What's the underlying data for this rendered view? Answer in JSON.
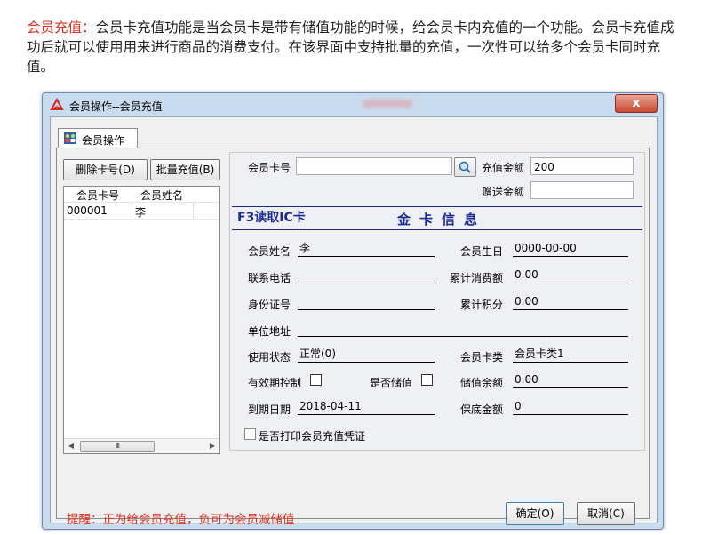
{
  "intro": {
    "highlight": "会员充值：",
    "text": "会员卡充值功能是当会员卡是带有储值功能的时候，给会员卡内充值的一个功能。会员卡充值成功后就可以使用用来进行商品的消费支付。在该界面中支持批量的充值，一次性可以给多个会员卡同时充值。"
  },
  "window": {
    "title": "会员操作--会员充值",
    "close_label": "x"
  },
  "tab": {
    "label": "会员操作"
  },
  "left_panel": {
    "delete_label": "删除卡号(D)",
    "batch_label": "批量充值(B)",
    "columns": [
      "会员卡号",
      "会员姓名"
    ],
    "rows": [
      {
        "card_no": "000001",
        "name": "李"
      }
    ],
    "scroll_thumb": "III"
  },
  "top_form": {
    "card_no_label": "会员卡号",
    "card_no_value": "",
    "recharge_label": "充值金额",
    "recharge_value": "200",
    "gift_label": "赠送金额",
    "gift_value": ""
  },
  "card_section": {
    "f3_label": "F3读取IC卡",
    "title": "金卡信息"
  },
  "card_info": {
    "name_label": "会员姓名",
    "name_value": "李",
    "birthday_label": "会员生日",
    "birthday_value": "0000-00-00",
    "phone_label": "联系电话",
    "phone_value": "",
    "consume_label": "累计消费额",
    "consume_value": "0.00",
    "id_label": "身份证号",
    "id_value": "",
    "points_label": "累计积分",
    "points_value": "0.00",
    "address_label": "单位地址",
    "address_value": "",
    "status_label": "使用状态",
    "status_value": "正常(0)",
    "cardtype_label": "会员卡类",
    "cardtype_value": "会员卡类1",
    "validity_label": "有效期控制",
    "stored_label": "是否储值",
    "balance_label": "储值余额",
    "balance_value": "0.00",
    "expire_label": "到期日期",
    "expire_value": "2018-04-11",
    "guarantee_label": "保底金额",
    "guarantee_value": "0"
  },
  "print_label": "是否打印会员充值凭证",
  "reminder": "提醒：正为给会员充值，负可为会员减储值",
  "buttons": {
    "ok": "确定(O)",
    "cancel": "取消(C)"
  },
  "colors": {
    "highlight_red": "#e0301e",
    "section_blue": "#1b2b8f",
    "window_frame": "#c9dcef"
  }
}
